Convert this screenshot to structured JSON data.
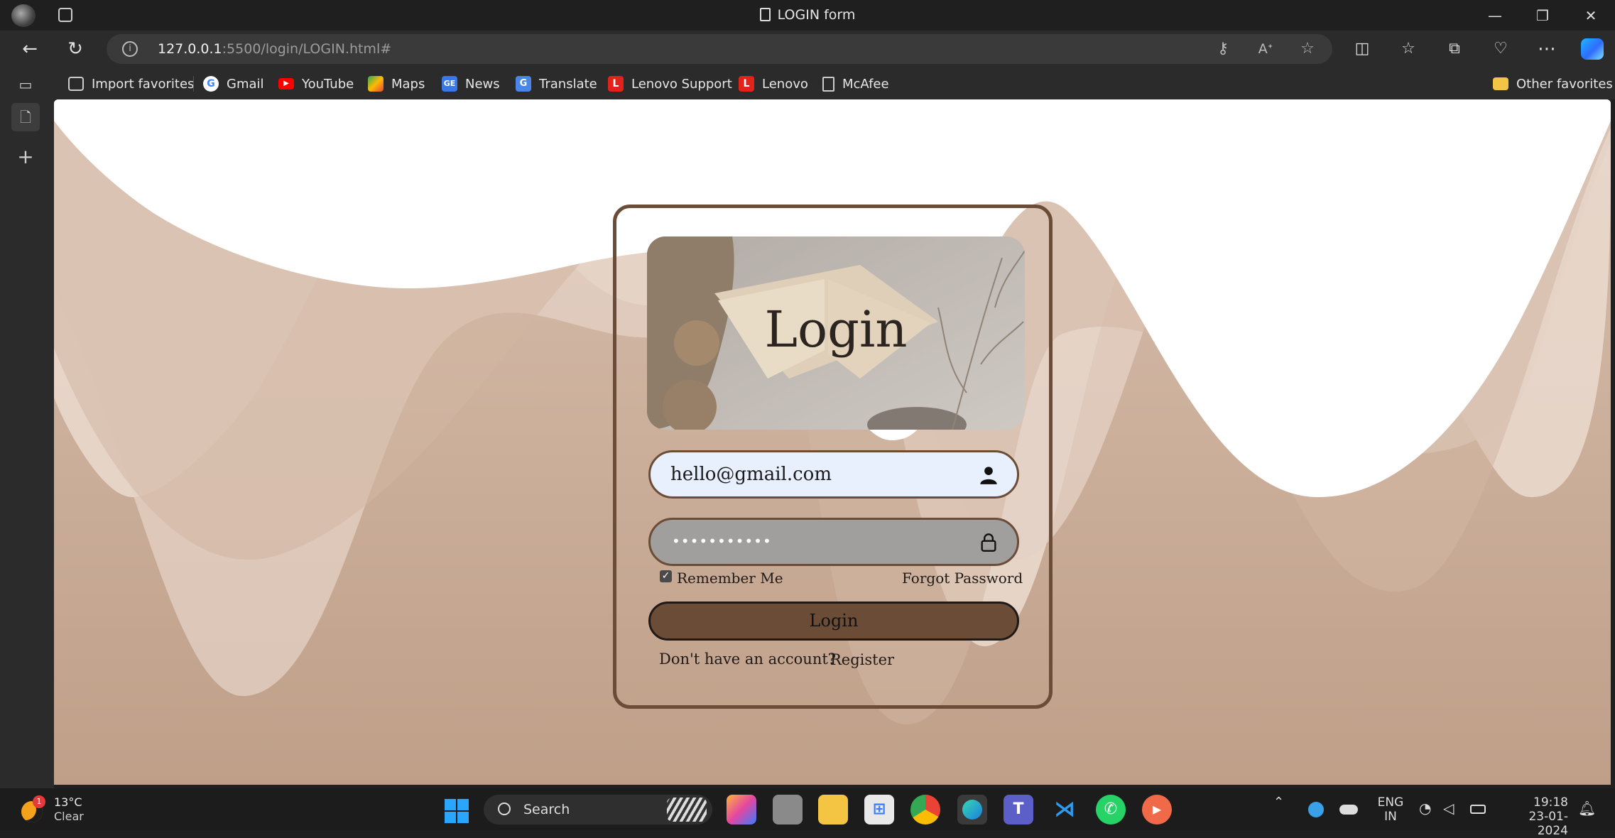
{
  "window": {
    "title": "LOGIN form"
  },
  "address_bar": {
    "url_host": "127.0.0.1",
    "url_path": ":5500/login/LOGIN.html#"
  },
  "bookmarks": [
    {
      "label": "Import favorites",
      "icon": "import-icon"
    },
    {
      "label": "Gmail",
      "icon": "google-icon"
    },
    {
      "label": "YouTube",
      "icon": "youtube-icon"
    },
    {
      "label": "Maps",
      "icon": "maps-icon"
    },
    {
      "label": "News",
      "icon": "news-icon"
    },
    {
      "label": "Translate",
      "icon": "translate-icon"
    },
    {
      "label": "Lenovo Support",
      "icon": "lenovo-icon"
    },
    {
      "label": "Lenovo",
      "icon": "lenovo-icon"
    },
    {
      "label": "McAfee",
      "icon": "page-icon"
    }
  ],
  "other_favorites": "Other favorites",
  "login": {
    "banner_title": "Login",
    "email_value": "hello@gmail.com",
    "password_mask": "•••••••••••",
    "remember_label": "Remember Me",
    "remember_checked": true,
    "forgot_label": "Forgot Password",
    "submit_label": "Login",
    "no_account_text": "Don't have an account?",
    "register_label": "Register"
  },
  "colors": {
    "accent_brown": "#6b4c36",
    "tan": "#c9a894",
    "field_blue": "#e8f0fe",
    "field_gray": "#a19e9e"
  },
  "taskbar": {
    "weather_badge": "1",
    "weather_temp": "13°C",
    "weather_desc": "Clear",
    "search_label": "Search",
    "lang_top": "ENG",
    "lang_bottom": "IN",
    "time": "19:18",
    "date": "23-01-2024"
  }
}
